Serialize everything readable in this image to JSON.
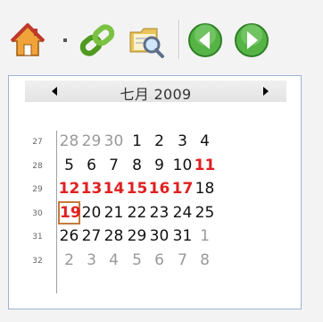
{
  "toolbar": {
    "buttons": [
      {
        "name": "home-button",
        "icon": "home-icon"
      },
      {
        "name": "home-dropdown-button",
        "icon": "dropdown-icon"
      },
      {
        "name": "link-button",
        "icon": "link-icon"
      },
      {
        "name": "search-button",
        "icon": "search-folder-icon"
      },
      {
        "name": "back-button",
        "icon": "back-arrow-icon"
      },
      {
        "name": "forward-button",
        "icon": "forward-arrow-icon"
      }
    ]
  },
  "calendar": {
    "month_title": "七月 2009",
    "accent_red": "#e02020",
    "today_border": "#c47a3e",
    "weeks": [
      {
        "week": "27",
        "days": [
          {
            "d": "28",
            "t": "other"
          },
          {
            "d": "29",
            "t": "other"
          },
          {
            "d": "30",
            "t": "other"
          },
          {
            "d": "1",
            "t": "normal"
          },
          {
            "d": "2",
            "t": "normal"
          },
          {
            "d": "3",
            "t": "normal"
          },
          {
            "d": "4",
            "t": "normal"
          }
        ]
      },
      {
        "week": "28",
        "days": [
          {
            "d": "5",
            "t": "normal"
          },
          {
            "d": "6",
            "t": "normal"
          },
          {
            "d": "7",
            "t": "normal"
          },
          {
            "d": "8",
            "t": "normal"
          },
          {
            "d": "9",
            "t": "normal"
          },
          {
            "d": "10",
            "t": "normal"
          },
          {
            "d": "11",
            "t": "weekend"
          }
        ]
      },
      {
        "week": "29",
        "days": [
          {
            "d": "12",
            "t": "weekend"
          },
          {
            "d": "13",
            "t": "weekend"
          },
          {
            "d": "14",
            "t": "weekend"
          },
          {
            "d": "15",
            "t": "weekend"
          },
          {
            "d": "16",
            "t": "weekend"
          },
          {
            "d": "17",
            "t": "weekend"
          },
          {
            "d": "18",
            "t": "normal"
          }
        ]
      },
      {
        "week": "30",
        "days": [
          {
            "d": "19",
            "t": "today"
          },
          {
            "d": "20",
            "t": "normal"
          },
          {
            "d": "21",
            "t": "normal"
          },
          {
            "d": "22",
            "t": "normal"
          },
          {
            "d": "23",
            "t": "normal"
          },
          {
            "d": "24",
            "t": "normal"
          },
          {
            "d": "25",
            "t": "normal"
          }
        ]
      },
      {
        "week": "31",
        "days": [
          {
            "d": "26",
            "t": "normal"
          },
          {
            "d": "27",
            "t": "normal"
          },
          {
            "d": "28",
            "t": "normal"
          },
          {
            "d": "29",
            "t": "normal"
          },
          {
            "d": "30",
            "t": "normal"
          },
          {
            "d": "31",
            "t": "normal"
          },
          {
            "d": "1",
            "t": "other"
          }
        ]
      },
      {
        "week": "32",
        "days": [
          {
            "d": "2",
            "t": "other"
          },
          {
            "d": "3",
            "t": "other"
          },
          {
            "d": "4",
            "t": "other"
          },
          {
            "d": "5",
            "t": "other"
          },
          {
            "d": "6",
            "t": "other"
          },
          {
            "d": "7",
            "t": "other"
          },
          {
            "d": "8",
            "t": "other"
          }
        ]
      }
    ]
  }
}
